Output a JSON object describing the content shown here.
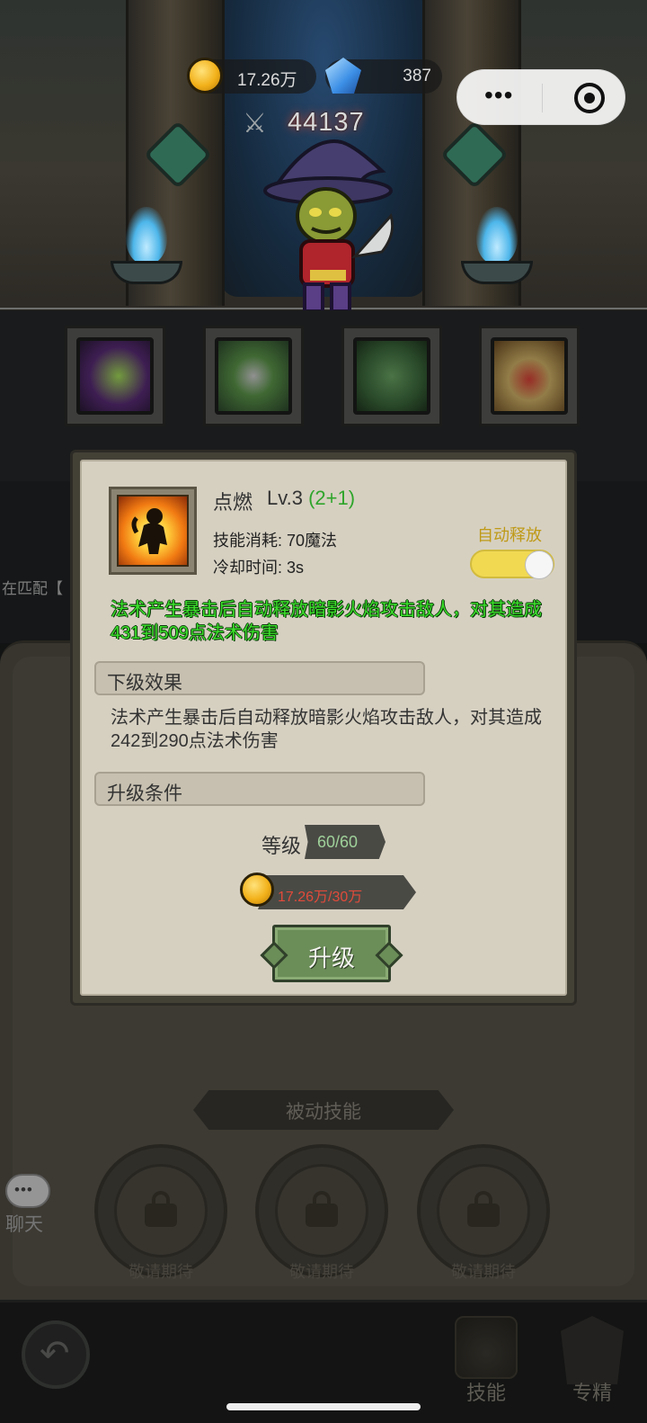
{
  "header": {
    "gold": "17.26万",
    "gems": "387",
    "power": "44137",
    "capsule_more": "•••"
  },
  "background": {
    "match_text": "在匹配【",
    "passive_title": "被动技能",
    "passive_slots": [
      {
        "label": "敬请期待"
      },
      {
        "label": "敬请期待"
      },
      {
        "label": "敬请期待"
      }
    ],
    "chat_label": "聊天",
    "nav": {
      "back_icon": "↶",
      "skill_tab": "技能",
      "expert_tab": "专精"
    }
  },
  "popup": {
    "skill_name": "点燃",
    "level": "Lv.3 ",
    "level_bonus": "(2+1)",
    "cost": "技能消耗: 70魔法",
    "cooldown": "冷却时间: 3s",
    "auto_label": "自动释放",
    "auto_enabled": true,
    "current_effect": "法术产生暴击后自动释放暗影火焰攻击敌人，对其造成431到509点法术伤害",
    "next_header": "下级效果",
    "next_effect": "法术产生暴击后自动释放暗影火焰攻击敌人，对其造成242到290点法术伤害",
    "cond_header": "升级条件",
    "level_req_label": "等级",
    "level_req_value": "60/60",
    "gold_req_value": "17.26万/30万",
    "upgrade_label": "升级"
  },
  "colors": {
    "effect_green": "#3ce02c",
    "cost_red": "#e14a3a",
    "toggle_yellow": "#f1d952",
    "upgrade_green": "#6b8d58"
  }
}
